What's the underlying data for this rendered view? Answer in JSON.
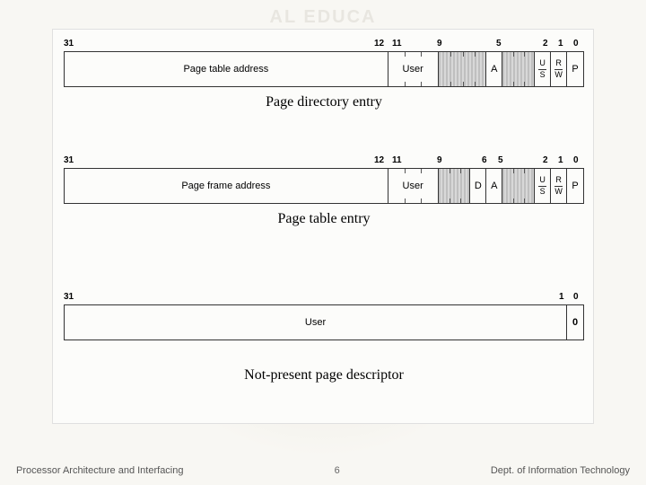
{
  "watermark_hint": "AL EDUCA",
  "diagrams": {
    "pde": {
      "bits": {
        "b31": "31",
        "b12": "12",
        "b11": "11",
        "b9": "9",
        "b5": "5",
        "b2": "2",
        "b1": "1",
        "b0": "0"
      },
      "fields": {
        "addr": "Page table address",
        "user": "User",
        "A": "A",
        "U": "U",
        "S": "S",
        "R": "R",
        "W": "W",
        "P": "P"
      },
      "caption": "Page directory entry"
    },
    "pte": {
      "bits": {
        "b31": "31",
        "b12": "12",
        "b11": "11",
        "b9": "9",
        "b6": "6",
        "b5": "5",
        "b2": "2",
        "b1": "1",
        "b0": "0"
      },
      "fields": {
        "addr": "Page frame address",
        "user": "User",
        "D": "D",
        "A": "A",
        "U": "U",
        "S": "S",
        "R": "R",
        "W": "W",
        "P": "P"
      },
      "caption": "Page table entry"
    },
    "np": {
      "bits": {
        "b31": "31",
        "b1": "1",
        "b0": "0"
      },
      "fields": {
        "user": "User",
        "zero": "0"
      },
      "caption": "Not-present page descriptor"
    }
  },
  "footer": {
    "left": "Processor Architecture and Interfacing",
    "page": "6",
    "right": "Dept. of Information Technology"
  }
}
